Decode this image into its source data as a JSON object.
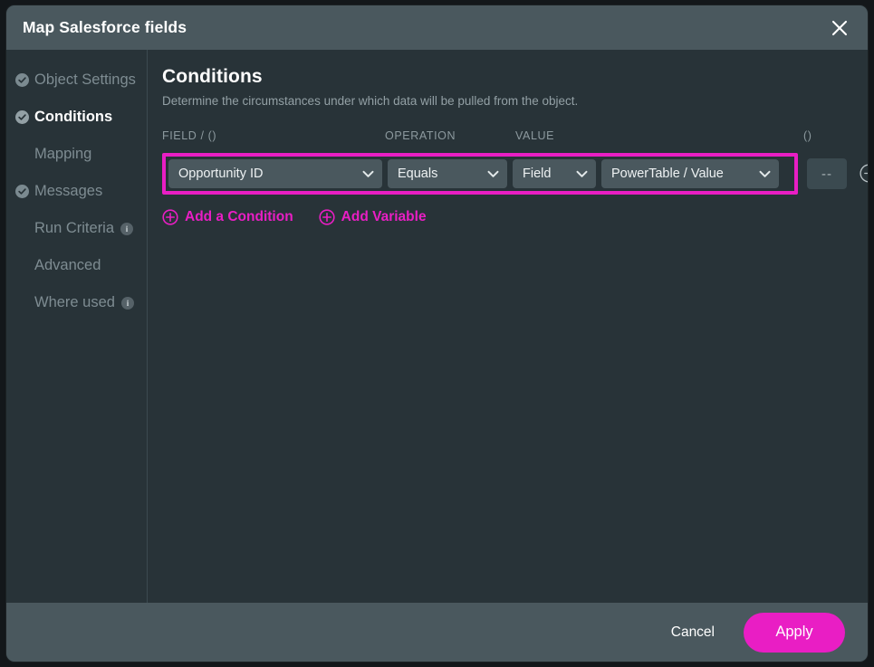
{
  "dialog": {
    "title": "Map Salesforce fields",
    "close_icon": "close-icon"
  },
  "sidebar": {
    "items": [
      {
        "label": "Object Settings",
        "completed": true,
        "active": false,
        "info": false
      },
      {
        "label": "Conditions",
        "completed": true,
        "active": true,
        "info": false
      },
      {
        "label": "Mapping",
        "completed": false,
        "active": false,
        "info": false
      },
      {
        "label": "Messages",
        "completed": true,
        "active": false,
        "info": false
      },
      {
        "label": "Run Criteria",
        "completed": false,
        "active": false,
        "info": true,
        "info_label": "i"
      },
      {
        "label": "Advanced",
        "completed": false,
        "active": false,
        "info": false
      },
      {
        "label": "Where used",
        "completed": false,
        "active": false,
        "info": true,
        "info_label": "i"
      }
    ]
  },
  "main": {
    "heading": "Conditions",
    "description": "Determine the circumstances under which data will be pulled from the object.",
    "columns": {
      "field": "FIELD / ()",
      "operation": "OPERATION",
      "value": "VALUE",
      "paren": "()"
    },
    "condition": {
      "field": "Opportunity ID",
      "operation": "Equals",
      "value_type": "Field",
      "value": "PowerTable / Value",
      "paren_close": "--",
      "remove_icon": "circle-minus-icon",
      "highlighted": true
    },
    "add_condition": "Add a Condition",
    "add_variable": "Add Variable"
  },
  "footer": {
    "cancel": "Cancel",
    "apply": "Apply"
  },
  "colors": {
    "accent": "#e91ec4",
    "titlebar": "#4a585e",
    "panel": "#283338",
    "control": "#4a585e",
    "muted_text": "#8d9a9f"
  }
}
